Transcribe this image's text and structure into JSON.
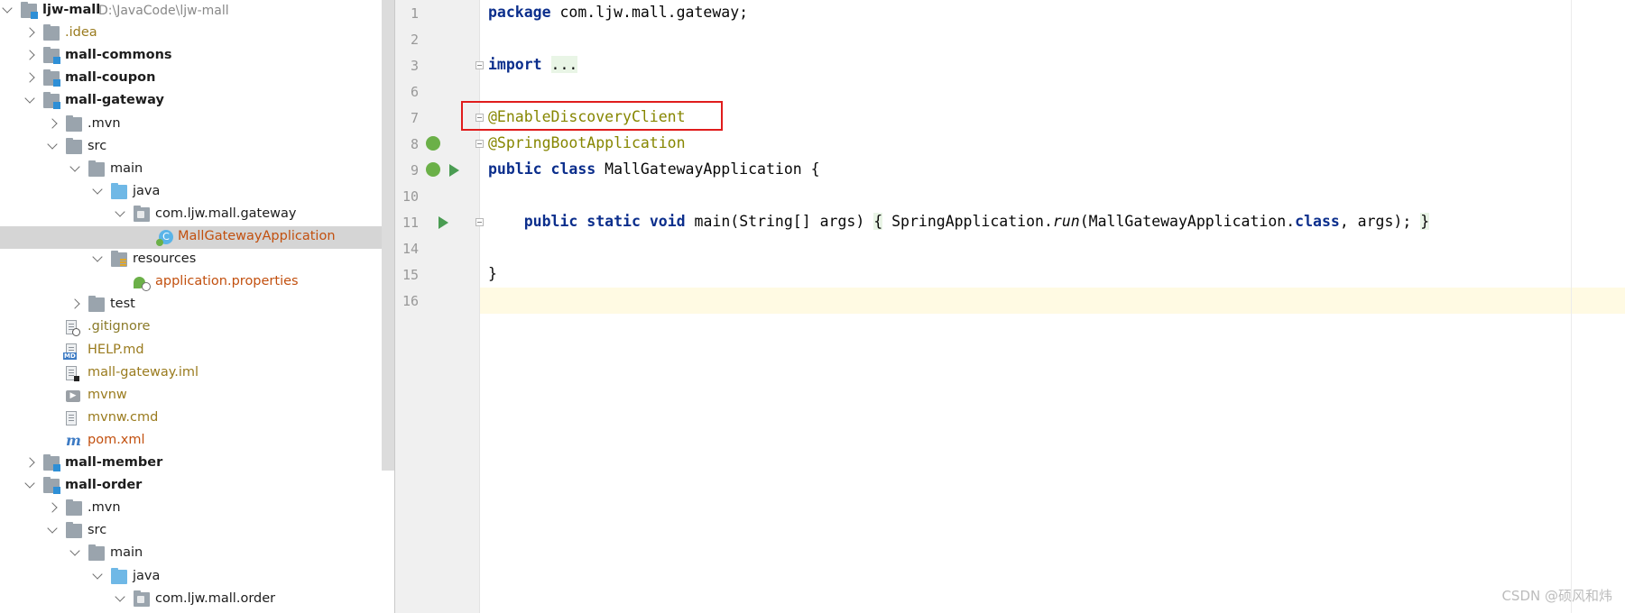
{
  "project_tree": [
    {
      "label": "ljw-mall",
      "path": "D:\\JavaCode\\ljw-mall",
      "style": "bold",
      "icon": "module-folder-icon",
      "arrow": "expanded"
    },
    {
      "label": ".idea",
      "style": "vcs",
      "icon": "folder-icon",
      "arrow": "collapsed"
    },
    {
      "label": "mall-commons",
      "style": "bold",
      "icon": "module-folder-icon",
      "arrow": "collapsed"
    },
    {
      "label": "mall-coupon",
      "style": "bold",
      "icon": "module-folder-icon",
      "arrow": "collapsed"
    },
    {
      "label": "mall-gateway",
      "style": "bold",
      "icon": "module-folder-icon",
      "arrow": "expanded"
    },
    {
      "label": ".mvn",
      "style": "normal",
      "icon": "folder-icon",
      "arrow": "collapsed"
    },
    {
      "label": "src",
      "style": "normal",
      "icon": "folder-icon",
      "arrow": "expanded"
    },
    {
      "label": "main",
      "style": "normal",
      "icon": "folder-icon",
      "arrow": "expanded"
    },
    {
      "label": "java",
      "style": "normal",
      "icon": "source-folder-icon",
      "arrow": "expanded"
    },
    {
      "label": "com.ljw.mall.gateway",
      "style": "normal",
      "icon": "package-icon",
      "arrow": "expanded"
    },
    {
      "label": "MallGatewayApplication",
      "style": "excl",
      "icon": "spring-class-icon",
      "arrow": "none",
      "selected": true
    },
    {
      "label": "resources",
      "style": "normal",
      "icon": "resources-folder-icon",
      "arrow": "expanded"
    },
    {
      "label": "application.properties",
      "style": "excl",
      "icon": "spring-properties-icon",
      "arrow": "none"
    },
    {
      "label": "test",
      "style": "normal",
      "icon": "folder-icon",
      "arrow": "collapsed"
    },
    {
      "label": ".gitignore",
      "style": "ignored",
      "icon": "gitignore-file-icon",
      "arrow": "none"
    },
    {
      "label": "HELP.md",
      "style": "vcs",
      "icon": "markdown-file-icon",
      "arrow": "none"
    },
    {
      "label": "mall-gateway.iml",
      "style": "vcs",
      "icon": "iml-file-icon",
      "arrow": "none"
    },
    {
      "label": "mvnw",
      "style": "vcs",
      "icon": "shell-script-icon",
      "arrow": "none"
    },
    {
      "label": "mvnw.cmd",
      "style": "vcs",
      "icon": "text-file-icon",
      "arrow": "none"
    },
    {
      "label": "pom.xml",
      "style": "xml",
      "icon": "maven-icon",
      "arrow": "none"
    },
    {
      "label": "mall-member",
      "style": "bold",
      "icon": "module-folder-icon",
      "arrow": "collapsed"
    },
    {
      "label": "mall-order",
      "style": "bold",
      "icon": "module-folder-icon",
      "arrow": "expanded"
    },
    {
      "label": ".mvn",
      "style": "normal",
      "icon": "folder-icon",
      "arrow": "collapsed"
    },
    {
      "label": "src",
      "style": "normal",
      "icon": "folder-icon",
      "arrow": "expanded"
    },
    {
      "label": "main",
      "style": "normal",
      "icon": "folder-icon",
      "arrow": "expanded"
    },
    {
      "label": "java",
      "style": "normal",
      "icon": "source-folder-icon",
      "arrow": "expanded"
    },
    {
      "label": "com.ljw.mall.order",
      "style": "normal",
      "icon": "package-icon",
      "arrow": "expanded"
    }
  ],
  "editor": {
    "lines": [
      {
        "number": "1",
        "tokens": [
          {
            "t": "package",
            "c": "kw"
          },
          {
            "t": " com.ljw.mall.gateway;",
            "c": "plain"
          }
        ]
      },
      {
        "number": "2",
        "tokens": []
      },
      {
        "number": "3",
        "tokens": [
          {
            "t": "import",
            "c": "kw"
          },
          {
            "t": " ",
            "c": "plain"
          },
          {
            "t": "...",
            "c": "fold"
          }
        ],
        "fold": true
      },
      {
        "number": "6",
        "tokens": []
      },
      {
        "number": "7",
        "tokens": [
          {
            "t": "@EnableDiscoveryClient",
            "c": "ann"
          }
        ],
        "fold": true
      },
      {
        "number": "8",
        "tokens": [
          {
            "t": "@SpringBootApplication",
            "c": "ann"
          }
        ],
        "fold": true,
        "gutter": "spring-bean-icon"
      },
      {
        "number": "9",
        "tokens": [
          {
            "t": "public",
            "c": "kw"
          },
          {
            "t": " ",
            "c": "plain"
          },
          {
            "t": "class",
            "c": "kw"
          },
          {
            "t": " MallGatewayApplication {",
            "c": "plain"
          }
        ],
        "gutter": "spring-run-icon"
      },
      {
        "number": "10",
        "tokens": []
      },
      {
        "number": "11",
        "tokens": [
          {
            "t": "    ",
            "c": "plain"
          },
          {
            "t": "public",
            "c": "kw"
          },
          {
            "t": " ",
            "c": "plain"
          },
          {
            "t": "static",
            "c": "kw"
          },
          {
            "t": " ",
            "c": "plain"
          },
          {
            "t": "void",
            "c": "kw"
          },
          {
            "t": " main(String[] args) ",
            "c": "plain"
          },
          {
            "t": "{",
            "c": "fold"
          },
          {
            "t": " SpringApplication.",
            "c": "plain"
          },
          {
            "t": "run",
            "c": "italic"
          },
          {
            "t": "(MallGatewayApplication.",
            "c": "plain"
          },
          {
            "t": "class",
            "c": "kw"
          },
          {
            "t": ", args); ",
            "c": "plain"
          },
          {
            "t": "}",
            "c": "fold"
          }
        ],
        "fold": true,
        "gutter": "run-icon"
      },
      {
        "number": "14",
        "tokens": []
      },
      {
        "number": "15",
        "tokens": [
          {
            "t": "}",
            "c": "plain"
          }
        ]
      },
      {
        "number": "16",
        "tokens": [],
        "current": true
      }
    ]
  },
  "watermark": "CSDN @硕风和炜",
  "colors": {
    "highlight_box": "#e01c1c",
    "keyword": "#0b2e8c",
    "annotation": "#868600",
    "selection": "#d5d5d5",
    "current_line": "#fffae3"
  }
}
